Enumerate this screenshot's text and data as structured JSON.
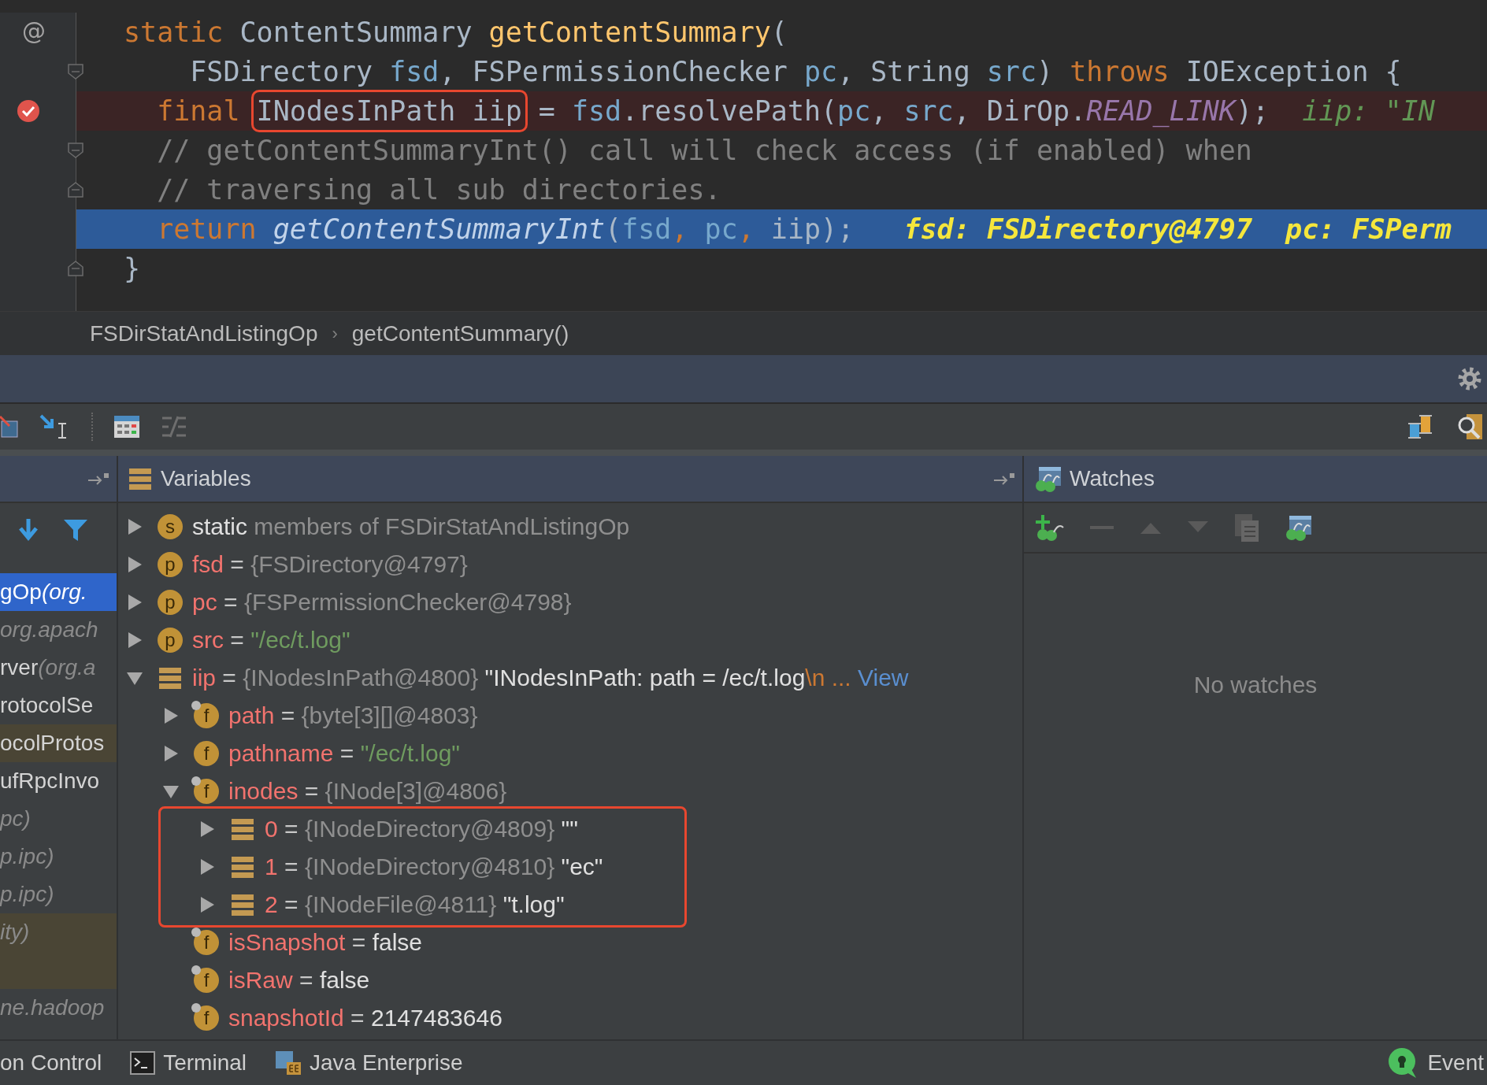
{
  "editor": {
    "lines": [
      {
        "breakpoint": false,
        "current": false,
        "fold_start": false,
        "fold_end": false,
        "gutter": "@",
        "tokens": [
          {
            "text": "static",
            "kind": "keyword"
          },
          {
            "text": " ContentSummary ",
            "kind": "plain"
          },
          {
            "text": "getContentSummary",
            "kind": "method"
          },
          {
            "text": "(",
            "kind": "plain"
          }
        ]
      },
      {
        "breakpoint": false,
        "current": false,
        "fold_start": true,
        "fold_end": false,
        "tokens": [
          {
            "text": "    FSDirectory ",
            "kind": "plain"
          },
          {
            "text": "fsd",
            "kind": "param"
          },
          {
            "text": ", FSPermissionChecker ",
            "kind": "plain"
          },
          {
            "text": "pc",
            "kind": "param"
          },
          {
            "text": ", String ",
            "kind": "plain"
          },
          {
            "text": "src",
            "kind": "param"
          },
          {
            "text": ") ",
            "kind": "plain"
          },
          {
            "text": "throws",
            "kind": "keyword"
          },
          {
            "text": " IOException {",
            "kind": "plain"
          }
        ]
      },
      {
        "breakpoint": true,
        "current": false,
        "fold_start": false,
        "fold_end": false,
        "tokens": [
          {
            "text": "  final ",
            "kind": "keyword"
          },
          {
            "text": "INodesInPath iip",
            "kind": "plain",
            "boxed": true
          },
          {
            "text": " = ",
            "kind": "plain"
          },
          {
            "text": "fsd",
            "kind": "param"
          },
          {
            "text": ".resolvePath(",
            "kind": "plain"
          },
          {
            "text": "pc",
            "kind": "param"
          },
          {
            "text": ", ",
            "kind": "plain"
          },
          {
            "text": "src",
            "kind": "param"
          },
          {
            "text": ", DirOp.",
            "kind": "plain"
          },
          {
            "text": "READ_LINK",
            "kind": "constant"
          },
          {
            "text": ");  ",
            "kind": "plain"
          },
          {
            "text": "iip: \"IN",
            "kind": "inline_green"
          }
        ]
      },
      {
        "breakpoint": false,
        "current": false,
        "fold_start": true,
        "fold_end": false,
        "tokens": [
          {
            "text": "  // getContentSummaryInt() call will check access (if enabled) when",
            "kind": "comment"
          }
        ]
      },
      {
        "breakpoint": false,
        "current": false,
        "fold_start": false,
        "fold_end": true,
        "tokens": [
          {
            "text": "  // traversing all sub directories.",
            "kind": "comment"
          }
        ]
      },
      {
        "breakpoint": false,
        "current": true,
        "fold_start": false,
        "fold_end": false,
        "tokens": [
          {
            "text": "  return ",
            "kind": "keyword"
          },
          {
            "text": "getContentSummaryInt",
            "kind": "call"
          },
          {
            "text": "(",
            "kind": "plain"
          },
          {
            "text": "fsd",
            "kind": "param"
          },
          {
            "text": ", ",
            "kind": "keyword"
          },
          {
            "text": "pc",
            "kind": "param"
          },
          {
            "text": ", ",
            "kind": "keyword"
          },
          {
            "text": "iip",
            "kind": "plain"
          },
          {
            "text": ");",
            "kind": "plain"
          },
          {
            "text": "   fsd: FSDirectory@4797  pc: FSPerm",
            "kind": "inline_yellow"
          }
        ]
      },
      {
        "breakpoint": false,
        "current": false,
        "fold_start": false,
        "fold_end": true,
        "tokens": [
          {
            "text": "}",
            "kind": "plain"
          }
        ]
      }
    ]
  },
  "breadcrumb": {
    "items": [
      "FSDirStatAndListingOp",
      "getContentSummary()"
    ],
    "separator": "›"
  },
  "frames": {
    "items": [
      {
        "text": "gOp",
        "detail": " (org.",
        "selected": true,
        "library": false
      },
      {
        "detail": "org.apach",
        "selected": false,
        "library": false
      },
      {
        "text": "rver",
        "detail": " (org.a",
        "selected": false,
        "library": false
      },
      {
        "text": "rotocolSe",
        "selected": false,
        "library": false
      },
      {
        "text": "ocolProtos",
        "selected": false,
        "library": true
      },
      {
        "text": "ufRpcInvo",
        "selected": false,
        "library": false
      },
      {
        "detail": "pc)",
        "selected": false,
        "library": false
      },
      {
        "detail": "p.ipc)",
        "selected": false,
        "library": false
      },
      {
        "detail": "p.ipc)",
        "selected": false,
        "library": false
      },
      {
        "detail": "ity)",
        "selected": false,
        "library": true,
        "kind": "tall"
      },
      {
        "detail": "ne.hadoop",
        "selected": false,
        "library": false
      }
    ]
  },
  "variables": {
    "title": "Variables",
    "rows": [
      {
        "kind": "badge",
        "badge": "s",
        "expanded": false,
        "name": "static",
        "name_plain": true,
        "parts": [
          {
            "text": " members of FSDirStatAndListingOp",
            "kind": "ref"
          }
        ]
      },
      {
        "kind": "badge",
        "badge": "p",
        "expanded": false,
        "name": "fsd",
        "parts": [
          {
            "text": " = ",
            "kind": "op"
          },
          {
            "text": "{FSDirectory@4797}",
            "kind": "ref"
          }
        ]
      },
      {
        "kind": "badge",
        "badge": "p",
        "expanded": false,
        "name": "pc",
        "parts": [
          {
            "text": " = ",
            "kind": "op"
          },
          {
            "text": "{FSPermissionChecker@4798}",
            "kind": "ref"
          }
        ]
      },
      {
        "kind": "badge",
        "badge": "p",
        "expanded": false,
        "name": "src",
        "parts": [
          {
            "text": " = ",
            "kind": "op"
          },
          {
            "text": "\"/ec/t.log\"",
            "kind": "string"
          }
        ]
      },
      {
        "kind": "object",
        "expanded": true,
        "name": "iip",
        "parts": [
          {
            "text": " = ",
            "kind": "op"
          },
          {
            "text": "{INodesInPath@4800}",
            "kind": "ref"
          },
          {
            "text": " \"INodesInPath: path = /ec/t.log",
            "kind": "text"
          },
          {
            "text": "\\n",
            "kind": "escape"
          },
          {
            "text": " ... ",
            "kind": "escape"
          },
          {
            "text": "View",
            "kind": "link"
          }
        ],
        "children": [
          {
            "kind": "badge",
            "badge": "f",
            "final_mark": true,
            "expanded": false,
            "name": "path",
            "parts": [
              {
                "text": " = ",
                "kind": "op"
              },
              {
                "text": "{byte[3][]@4803}",
                "kind": "ref"
              }
            ]
          },
          {
            "kind": "badge",
            "badge": "f",
            "final_mark": false,
            "expanded": false,
            "name": "pathname",
            "parts": [
              {
                "text": " = ",
                "kind": "op"
              },
              {
                "text": "\"/ec/t.log\"",
                "kind": "string"
              }
            ]
          },
          {
            "kind": "badge",
            "badge": "f",
            "final_mark": true,
            "expanded": true,
            "boxed_children": true,
            "name": "inodes",
            "parts": [
              {
                "text": " = ",
                "kind": "op"
              },
              {
                "text": "{INode[3]@4806}",
                "kind": "ref"
              }
            ],
            "children": [
              {
                "kind": "object",
                "expanded": false,
                "name": "0",
                "parts": [
                  {
                    "text": " = ",
                    "kind": "op"
                  },
                  {
                    "text": "{INodeDirectory@4809}",
                    "kind": "ref"
                  },
                  {
                    "text": " \"\"",
                    "kind": "text"
                  }
                ]
              },
              {
                "kind": "object",
                "expanded": false,
                "name": "1",
                "parts": [
                  {
                    "text": " = ",
                    "kind": "op"
                  },
                  {
                    "text": "{INodeDirectory@4810}",
                    "kind": "ref"
                  },
                  {
                    "text": " \"ec\"",
                    "kind": "text"
                  }
                ]
              },
              {
                "kind": "object",
                "expanded": false,
                "name": "2",
                "parts": [
                  {
                    "text": " = ",
                    "kind": "op"
                  },
                  {
                    "text": "{INodeFile@4811}",
                    "kind": "ref"
                  },
                  {
                    "text": " \"t.log\"",
                    "kind": "text"
                  }
                ]
              }
            ]
          },
          {
            "kind": "badge",
            "badge": "f",
            "final_mark": true,
            "name": "isSnapshot",
            "parts": [
              {
                "text": " = ",
                "kind": "op"
              },
              {
                "text": "false",
                "kind": "text"
              }
            ]
          },
          {
            "kind": "badge",
            "badge": "f",
            "final_mark": true,
            "name": "isRaw",
            "parts": [
              {
                "text": " = ",
                "kind": "op"
              },
              {
                "text": "false",
                "kind": "text"
              }
            ]
          },
          {
            "kind": "badge",
            "badge": "f",
            "final_mark": true,
            "name": "snapshotId",
            "parts": [
              {
                "text": " = ",
                "kind": "op"
              },
              {
                "text": "2147483646",
                "kind": "text"
              }
            ]
          }
        ]
      }
    ]
  },
  "watches": {
    "title": "Watches",
    "empty_text": "No watches"
  },
  "bottom_bar": {
    "left": [
      "on Control",
      "Terminal",
      "Java Enterprise"
    ],
    "right": [
      "Event"
    ]
  }
}
